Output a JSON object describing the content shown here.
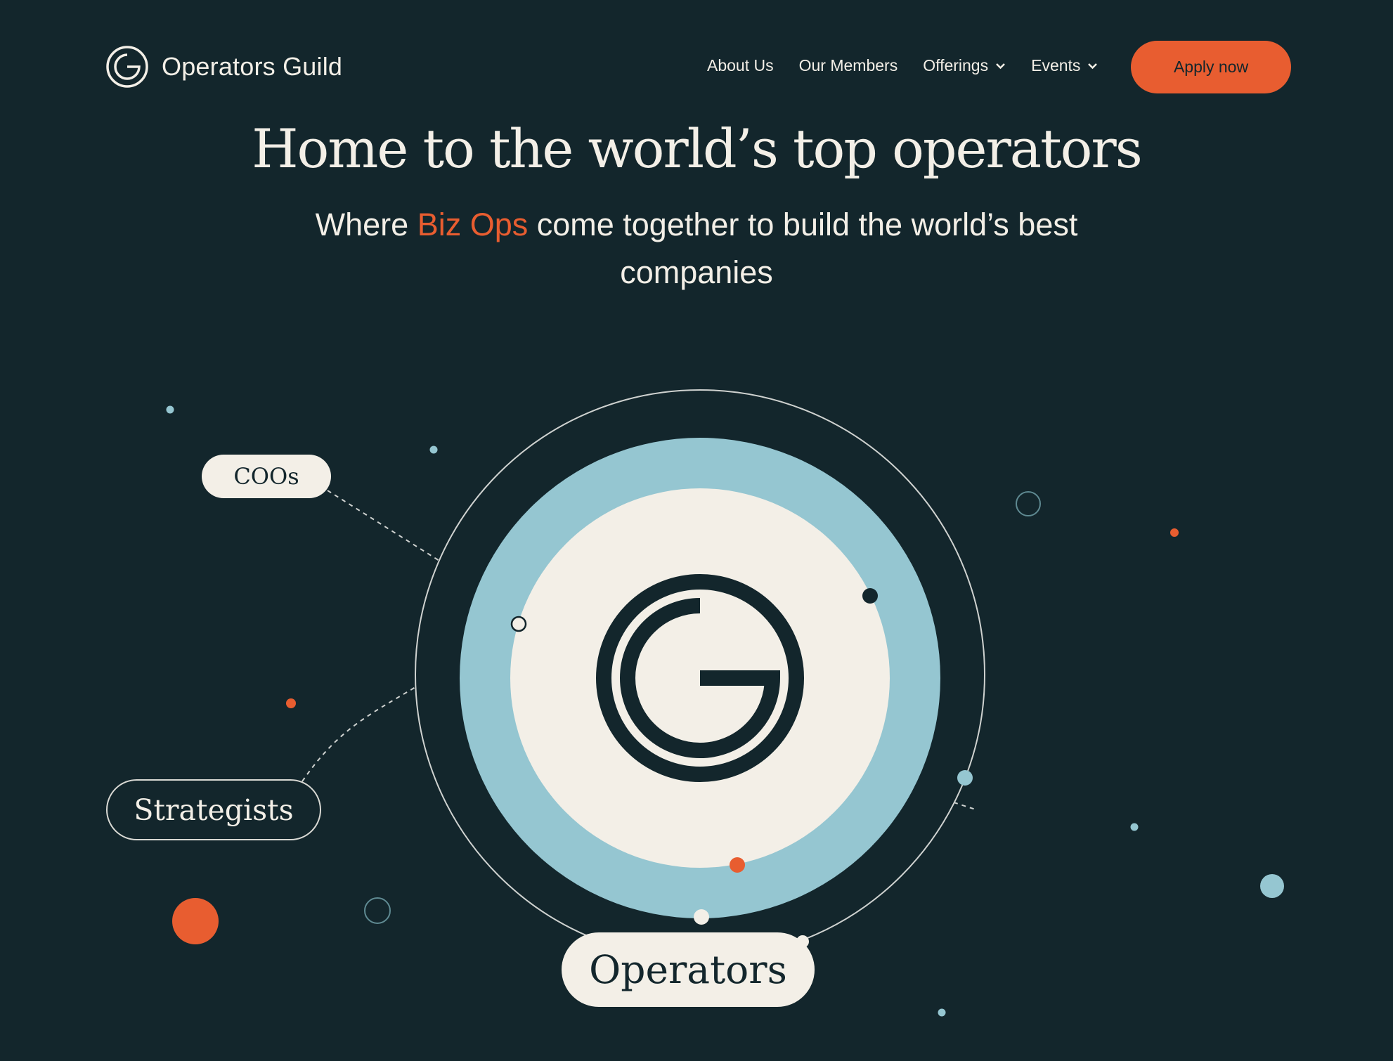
{
  "brand": {
    "name": "Operators Guild",
    "logo_icon": "g-ring-logo-icon"
  },
  "nav": {
    "items": [
      {
        "label": "About Us",
        "has_dropdown": false
      },
      {
        "label": "Our Members",
        "has_dropdown": false
      },
      {
        "label": "Offerings",
        "has_dropdown": true
      },
      {
        "label": "Events",
        "has_dropdown": true
      }
    ],
    "cta_label": "Apply now"
  },
  "hero": {
    "headline": "Home to the world’s top operators",
    "subtitle_prefix": "Where ",
    "subtitle_accent": "Biz Ops",
    "subtitle_suffix": " come together to build the world’s best companies"
  },
  "graphic": {
    "labels": {
      "coos": "COOs",
      "strategists": "Strategists",
      "operators": "Operators"
    },
    "center_icon": "g-logo-icon"
  },
  "colors": {
    "background": "#13262c",
    "accent": "#e85d30",
    "cream": "#f3efe7",
    "light_blue": "#95c6d1"
  }
}
